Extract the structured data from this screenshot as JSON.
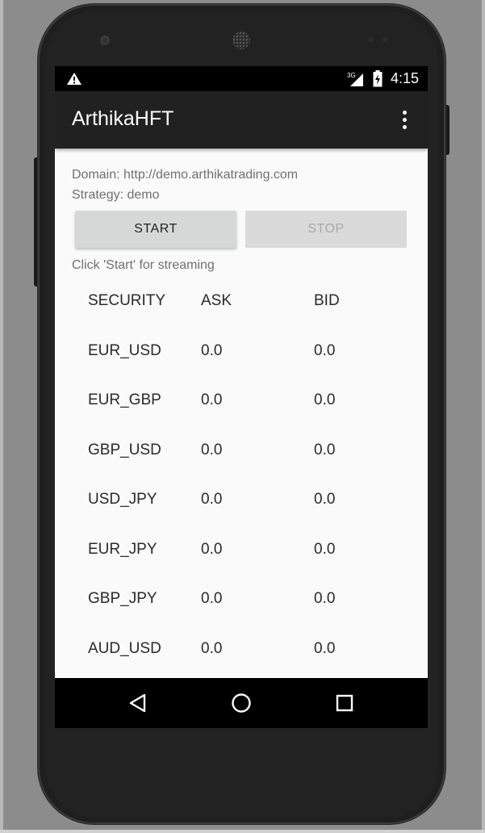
{
  "status_bar": {
    "network": "3G",
    "time": "4:15"
  },
  "app_bar": {
    "title": "ArthikaHFT",
    "menu_icon": "more-vert-icon"
  },
  "info": {
    "domain": "Domain: http://demo.arthikatrading.com",
    "strategy": "Strategy: demo"
  },
  "buttons": {
    "start": "START",
    "stop": "STOP"
  },
  "hint": "Click 'Start' for streaming",
  "table": {
    "headers": [
      "SECURITY",
      "ASK",
      "BID"
    ],
    "rows": [
      {
        "security": "EUR_USD",
        "ask": "0.0",
        "bid": "0.0"
      },
      {
        "security": "EUR_GBP",
        "ask": "0.0",
        "bid": "0.0"
      },
      {
        "security": "GBP_USD",
        "ask": "0.0",
        "bid": "0.0"
      },
      {
        "security": "USD_JPY",
        "ask": "0.0",
        "bid": "0.0"
      },
      {
        "security": "EUR_JPY",
        "ask": "0.0",
        "bid": "0.0"
      },
      {
        "security": "GBP_JPY",
        "ask": "0.0",
        "bid": "0.0"
      },
      {
        "security": "AUD_USD",
        "ask": "0.0",
        "bid": "0.0"
      }
    ]
  },
  "nav": {
    "back_icon": "back-triangle-icon",
    "home_icon": "home-circle-icon",
    "recents_icon": "recents-square-icon"
  },
  "colors": {
    "app_bar": "#212121",
    "screen_bg": "#fafafa",
    "button_bg": "#d6d7d7",
    "disabled_text": "#a8a8a8"
  }
}
